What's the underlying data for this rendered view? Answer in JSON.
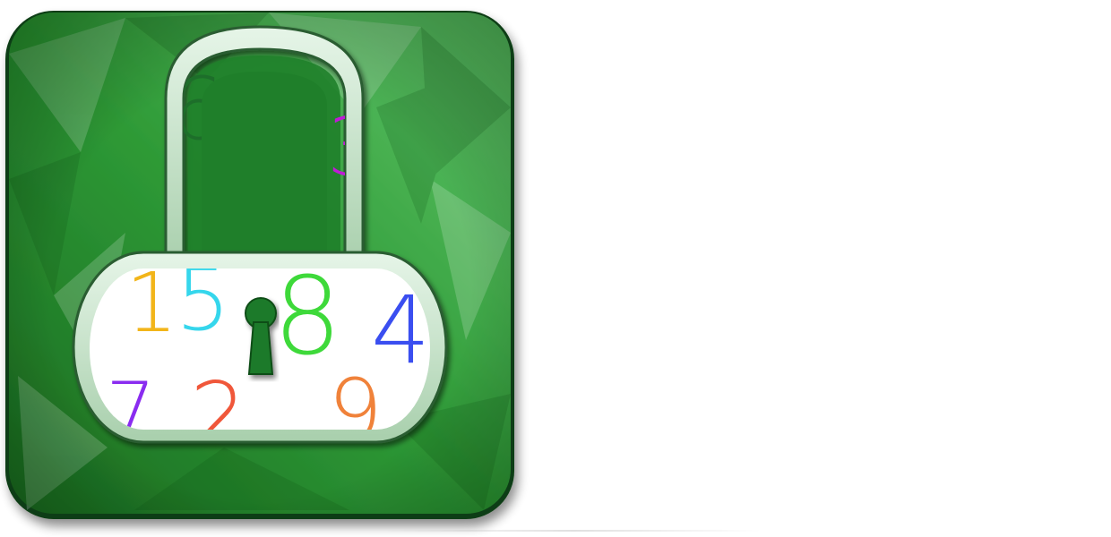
{
  "icon": {
    "name": "padlock-app-icon",
    "colors": {
      "background_dark": "#1b6e22",
      "background_mid": "#2f9e3a",
      "background_light": "#5cc468",
      "lock_body_fill": "#ffffff",
      "keyhole": "#1f7a2a",
      "bevel_light": "#d9f2dc",
      "bevel_dark": "#0f4a16"
    },
    "digits": [
      {
        "text": "6",
        "color": "#1d6e2a"
      },
      {
        "text": "3",
        "color": "#c01ad6"
      },
      {
        "text": "1",
        "color": "#f2b51a"
      },
      {
        "text": "5",
        "color": "#35d6ec"
      },
      {
        "text": "8",
        "color": "#3ed93a"
      },
      {
        "text": "4",
        "color": "#3a4ef0"
      },
      {
        "text": "7",
        "color": "#8a2cf0"
      },
      {
        "text": "2",
        "color": "#f0573a"
      },
      {
        "text": "9",
        "color": "#f0823a"
      }
    ]
  }
}
